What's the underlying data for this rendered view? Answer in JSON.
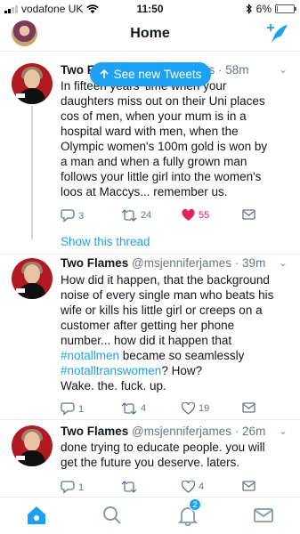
{
  "status_bar": {
    "carrier": "vodafone UK",
    "time": "11:50",
    "battery": "6%",
    "battery_level": 0.06
  },
  "header": {
    "title": "Home",
    "avatar_icon": "profile-avatar",
    "compose_icon": "compose-tweet-icon"
  },
  "new_tweets_pill": {
    "label": "See new Tweets",
    "icon": "arrow-up-icon"
  },
  "tweets": [
    {
      "name": "Two F",
      "handle_tail": "mes",
      "dot": " · ",
      "time": "58m",
      "lines": [
        "In fifteen years' time when your",
        "daughters miss out on their Uni places",
        "cos of men, when your mum is in a",
        "hospital ward with men, when the",
        "Olympic women's 100m gold is won by",
        "a man and when a fully grown man",
        "follows your little girl into the women's",
        "loos at Maccys... remember us."
      ],
      "replies": "3",
      "retweets": "24",
      "likes": "55",
      "liked": true
    },
    {
      "show_thread": "Show this thread"
    },
    {
      "name": "Two Flames",
      "handle": "@msjenniferjames",
      "dot": " · ",
      "time": "39m",
      "lines_plain_1": [
        "How did it happen, that the background",
        "noise of every single man who beats his",
        "wife or kills his little girl or creeps on a",
        "customer after getting her phone",
        "number... how did it happen that"
      ],
      "hashtag_1": "#notallmen",
      "line_after_hashtag_1": " became so seamlessly",
      "hashtag_2": "#notalltranswomen",
      "line_after_hashtag_2": "? How?",
      "final_line": "Wake. the. fuck. up.",
      "replies": "1",
      "retweets": "4",
      "likes": "19",
      "liked": false
    },
    {
      "name": "Two Flames",
      "handle": "@msjenniferjames",
      "dot": " · ",
      "time": "26m",
      "lines": [
        "done trying to educate people. you will",
        "get the future you deserve. laters."
      ],
      "replies": "1",
      "retweets": "",
      "likes": "4",
      "liked": false
    }
  ],
  "tab_bar": {
    "tabs": [
      "home-icon",
      "search-icon",
      "notifications-icon",
      "messages-icon"
    ],
    "notifications_badge": "2",
    "active_color": "#1da1f2",
    "inactive_color": "#8899a6"
  },
  "colors": {
    "accent": "#1da1f2",
    "like": "#e0245e",
    "secondary_text": "#657786"
  }
}
